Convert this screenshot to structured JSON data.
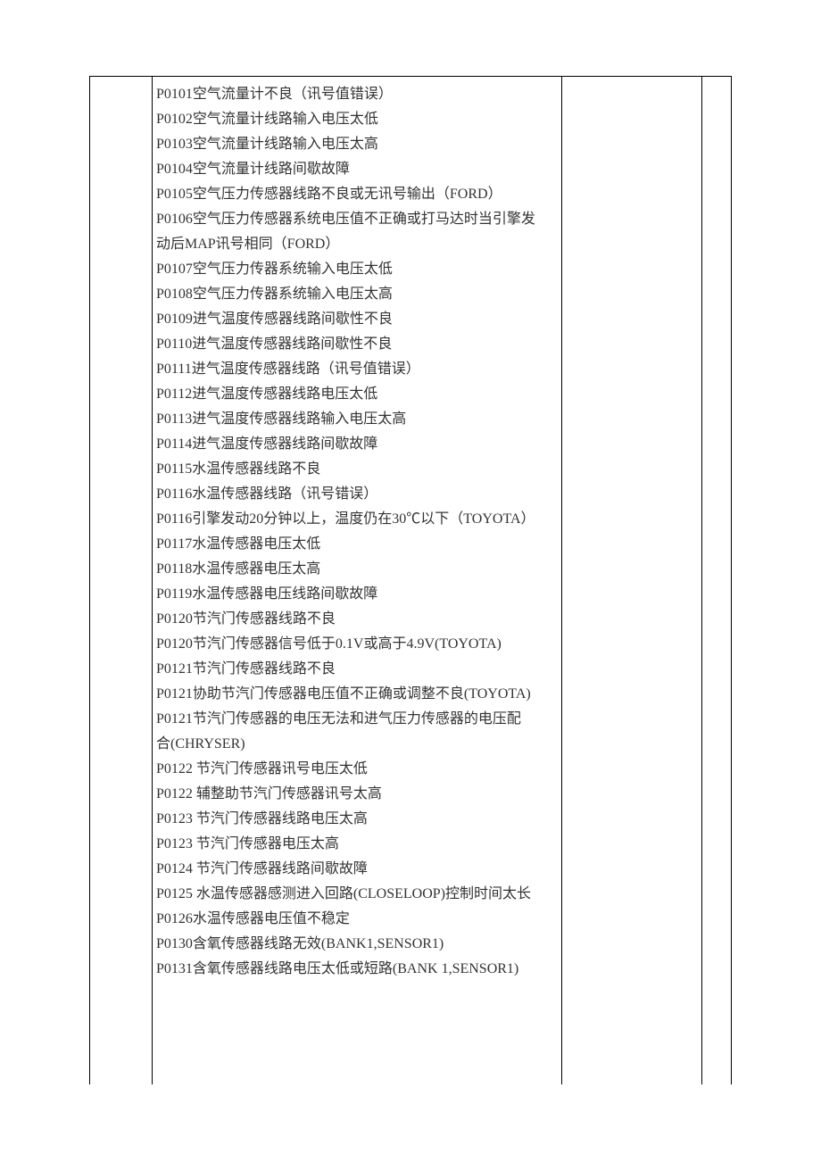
{
  "codes": {
    "lines": [
      "P0101空气流量计不良（讯号值错误）",
      "P0102空气流量计线路输入电压太低",
      "P0103空气流量计线路输入电压太高",
      "P0104空气流量计线路间歇故障",
      "P0105空气压力传感器线路不良或无讯号输出（FORD）",
      "P0106空气压力传感器系统电压值不正确或打马达时当引擎发",
      "动后MAP讯号相同（FORD）",
      "P0107空气压力传器系统输入电压太低",
      "P0108空气压力传器系统输入电压太高",
      "P0109进气温度传感器线路间歇性不良",
      "P0110进气温度传感器线路间歇性不良",
      "P0111进气温度传感器线路（讯号值错误）",
      "P0112进气温度传感器线路电压太低",
      "P0113进气温度传感器线路输入电压太高",
      "P0114进气温度传感器线路间歇故障",
      "P0115水温传感器线路不良",
      "P0116水温传感器线路（讯号错误）",
      "P0116引擎发动20分钟以上，温度仍在30℃以下（TOYOTA）",
      "P0117水温传感器电压太低",
      "P0118水温传感器电压太高",
      "P0119水温传感器电压线路间歇故障",
      "P0120节汽门传感器线路不良",
      "P0120节汽门传感器信号低于0.1V或高于4.9V(TOYOTA)",
      "P0121节汽门传感器线路不良",
      "P0121协助节汽门传感器电压值不正确或调整不良(TOYOTA)",
      "P0121节汽门传感器的电压无法和进气压力传感器的电压配",
      "合(CHRYSER)",
      "P0122  节汽门传感器讯号电压太低",
      "P0122  辅整助节汽门传感器讯号太高",
      "P0123  节汽门传感器线路电压太高",
      "P0123  节汽门传感器电压太高",
      "P0124  节汽门传感器线路间歇故障",
      "P0125  水温传感器感测进入回路(CLOSELOOP)控制时间太长",
      "P0126水温传感器电压值不稳定",
      "P0130含氧传感器线路无效(BANK1,SENSOR1)",
      "P0131含氧传感器线路电压太低或短路(BANK 1,SENSOR1)"
    ]
  }
}
